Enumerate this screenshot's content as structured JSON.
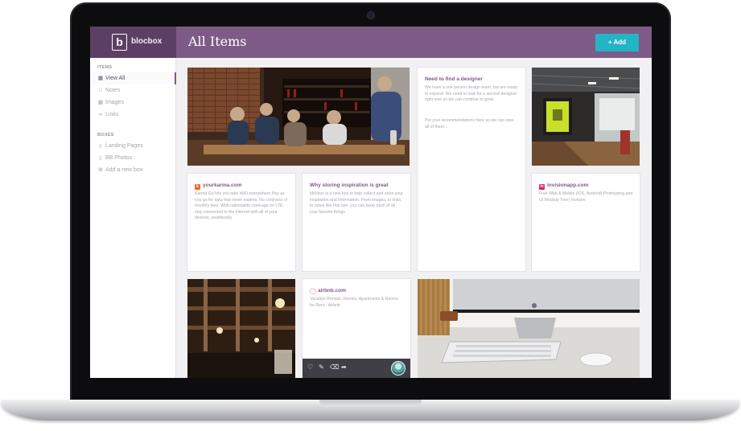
{
  "app": {
    "brand_letter": "b",
    "brand_name": "blocbox",
    "page_title": "All Items",
    "add_label": "+ Add"
  },
  "sidebar": {
    "items_section": "ITEMS",
    "items": [
      {
        "icon": "grid-icon",
        "label": "View All"
      },
      {
        "icon": "note-icon",
        "label": "Notes"
      },
      {
        "icon": "image-icon",
        "label": "Images"
      },
      {
        "icon": "link-icon",
        "label": "Links"
      }
    ],
    "boxes_section": "BOXES",
    "boxes": [
      {
        "icon": "box-icon",
        "label": "Landing Pages"
      },
      {
        "icon": "box-icon",
        "label": "BB Photos"
      },
      {
        "icon": "plus-icon",
        "label": "Add a new box"
      }
    ]
  },
  "cards": {
    "designer": {
      "title": "Need to find a designer",
      "text1": "We have a one person design team, but are ready to expand. We need to look for a second designer right now so we can continue to grow.",
      "text2": "Put your recommendations here so we can view all of them..."
    },
    "yourkarma": {
      "title": "yourkarma.com",
      "text": "Karma Go lets you take WiFi everywhere Pay as you go for data that never expires. No contracts or monthly fees. With nationwide coverage on LTE, stay connected to the internet with all of your devices, seamlessly."
    },
    "inspiration": {
      "title": "Why storing inspiration is great",
      "text": "blocbox is a new tool to help collect and store your inspiration and information. From images, to links, to notes like this one, you can keep track of all your favorite things."
    },
    "invision": {
      "title": "invisionapp.com",
      "text": "Free Web & Mobile (iOS, Android) Prototyping and UI Mockup Tool | Invision"
    },
    "airbnb": {
      "title": "airbnb.com",
      "text": "Vacation Rentals, Homes, Apartments & Rooms for Rent - Airbnb"
    }
  },
  "colors": {
    "header": "#7e5b86",
    "brand_bg": "#5c3f64",
    "accent": "#23b4c6",
    "title": "#7e5b86"
  }
}
